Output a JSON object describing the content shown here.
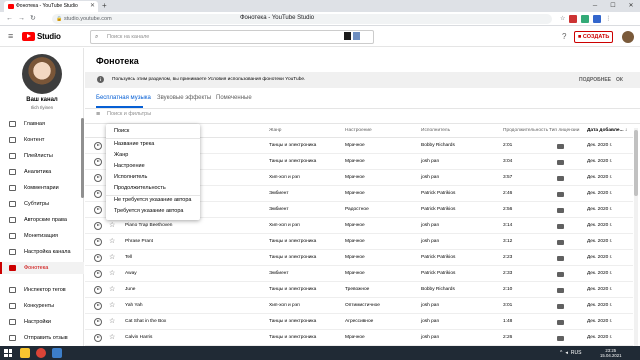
{
  "browser": {
    "tab_title": "Фонотека - YouTube Studio",
    "url": "studio.youtube.com",
    "page_title": "Фонотека - YouTube Studio"
  },
  "header": {
    "logo_text": "Studio",
    "search_placeholder": "Поиск на канале",
    "create_label": "СОЗДАТЬ"
  },
  "sidebar": {
    "channel_name": "Ваш канал",
    "channel_sub": "Ilich Ilyinen",
    "items": [
      {
        "label": "Главная"
      },
      {
        "label": "Контент"
      },
      {
        "label": "Плейлисты"
      },
      {
        "label": "Аналитика"
      },
      {
        "label": "Комментарии"
      },
      {
        "label": "Субтитры"
      },
      {
        "label": "Авторские права"
      },
      {
        "label": "Монетизация"
      },
      {
        "label": "Настройка канала"
      },
      {
        "label": "Фонотека",
        "active": true
      },
      {
        "label": "Инспектор тегов"
      },
      {
        "label": "Конкуренты"
      },
      {
        "label": "Настройки"
      },
      {
        "label": "Отправить отзыв"
      }
    ]
  },
  "main": {
    "title": "Фонотека",
    "notice": "Пользуясь этим разделом, вы принимаете Условия использования фонотеки YouTube.",
    "notice_more": "ПОДРОБНЕЕ",
    "notice_ok": "ОК",
    "tabs": [
      {
        "label": "Бесплатная музыка",
        "selected": true
      },
      {
        "label": "Звуковые эффекты"
      },
      {
        "label": "Помеченные"
      }
    ],
    "filter_placeholder": "Поиск и фильтры",
    "columns": [
      "Жанр",
      "Настроение",
      "Исполнитель",
      "Продолжительность",
      "Тип лицензии",
      "Дата добавле... ↓"
    ],
    "rows": [
      {
        "title": "",
        "genre": "Танцы и электроника",
        "mood": "Мрачное",
        "artist": "Bobby Richards",
        "duration": "2:01",
        "date": "Дек. 2020 г."
      },
      {
        "title": "",
        "genre": "Танцы и электроника",
        "mood": "Мрачное",
        "artist": "josh pan",
        "duration": "3:04",
        "date": "Дек. 2020 г."
      },
      {
        "title": "",
        "genre": "Хип-хоп и рэп",
        "mood": "Мрачное",
        "artist": "josh pan",
        "duration": "3:57",
        "date": "Дек. 2020 г."
      },
      {
        "title": "",
        "genre": "Эмбиент",
        "mood": "Мрачное",
        "artist": "Patrick Patrikios",
        "duration": "2:46",
        "date": "Дек. 2020 г."
      },
      {
        "title": "",
        "genre": "Эмбиент",
        "mood": "Радостное",
        "artist": "Patrick Patrikios",
        "duration": "2:56",
        "date": "Дек. 2020 г."
      },
      {
        "title": "Piano Trap Beethoven",
        "genre": "Хип-хоп и рэп",
        "mood": "Мрачное",
        "artist": "josh pan",
        "duration": "3:14",
        "date": "Дек. 2020 г."
      },
      {
        "title": "Phrase Prant",
        "genre": "Танцы и электроника",
        "mood": "Мрачное",
        "artist": "josh pan",
        "duration": "3:12",
        "date": "Дек. 2020 г."
      },
      {
        "title": "Tell",
        "genre": "Танцы и электроника",
        "mood": "Мрачное",
        "artist": "Patrick Patrikios",
        "duration": "2:23",
        "date": "Дек. 2020 г."
      },
      {
        "title": "Away",
        "genre": "Эмбиент",
        "mood": "Мрачное",
        "artist": "Patrick Patrikios",
        "duration": "2:33",
        "date": "Дек. 2020 г."
      },
      {
        "title": "June",
        "genre": "Танцы и электроника",
        "mood": "Тревожное",
        "artist": "Bobby Richards",
        "duration": "2:10",
        "date": "Дек. 2020 г."
      },
      {
        "title": "Yah Yah",
        "genre": "Хип-хоп и рэп",
        "mood": "Оптимистичное",
        "artist": "josh pan",
        "duration": "3:01",
        "date": "Дек. 2020 г."
      },
      {
        "title": "Cat Shat in the Box",
        "genre": "Танцы и электроника",
        "mood": "Агрессивное",
        "artist": "josh pan",
        "duration": "1:48",
        "date": "Дек. 2020 г."
      },
      {
        "title": "Calvin Harris",
        "genre": "Танцы и электроника",
        "mood": "Мрачное",
        "artist": "josh pan",
        "duration": "2:26",
        "date": "Дек. 2020 г."
      }
    ]
  },
  "dropdown": {
    "header": "Поиск",
    "group1": [
      "Название трека",
      "Жанр",
      "Настроение",
      "Исполнитель",
      "Продолжительность"
    ],
    "group2": [
      "Не требуется указание автора",
      "Требуется указание автора"
    ]
  },
  "taskbar": {
    "lang": "RUS",
    "time": "23:25",
    "date": "15.04.2021"
  },
  "colors": {
    "accent_blue": "#065fd4",
    "brand_red": "#ff0000",
    "active_red": "#cc0000"
  }
}
